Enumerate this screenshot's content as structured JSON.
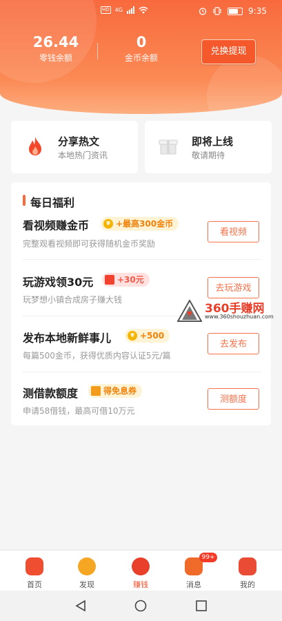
{
  "status_bar": {
    "hd_label": "HD",
    "net_label": "4G",
    "time": "9:35"
  },
  "wallet": {
    "change_value": "26.44",
    "change_label": "零钱余额",
    "coin_value": "0",
    "coin_label": "金币余额",
    "redeem_button": "兑换提现"
  },
  "features": [
    {
      "title": "分享热文",
      "subtitle": "本地热门资讯",
      "icon": "fire-icon"
    },
    {
      "title": "即将上线",
      "subtitle": "敬请期待",
      "icon": "gift-box-icon"
    }
  ],
  "daily_section": {
    "title": "每日福利",
    "tasks": [
      {
        "title": "看视频赚金币",
        "badge": "+最高300金币",
        "badge_icon": "coin-icon",
        "desc": "完整观看视频即可获得随机金币奖励",
        "button": "看视频"
      },
      {
        "title": "玩游戏领30元",
        "badge": "+30元",
        "badge_icon": "red-envelope-icon",
        "desc": "玩梦想小镇合成房子赚大钱",
        "button": "去玩游戏"
      },
      {
        "title": "发布本地新鲜事儿",
        "badge": "+500",
        "badge_icon": "coin-icon",
        "desc": "每篇500金币，获得优质内容认证5元/篇",
        "button": "去发布"
      },
      {
        "title": "测借款额度",
        "badge": "得免息券",
        "badge_icon": "coupon-icon",
        "desc": "申请58借钱，最高可借10万元",
        "button": "测额度"
      }
    ]
  },
  "watermark": {
    "brand": "360手赚网",
    "url": "www.360shouzhuan.com"
  },
  "tabbar": [
    {
      "label": "首页",
      "icon": "home-icon",
      "color": "#f04e30"
    },
    {
      "label": "发现",
      "icon": "discover-icon",
      "color": "#f5a623"
    },
    {
      "label": "赚钱",
      "icon": "earn-icon",
      "color": "#e8402a",
      "active": true
    },
    {
      "label": "消息",
      "icon": "message-icon",
      "color": "#f06a2a",
      "badge": "99+"
    },
    {
      "label": "我的",
      "icon": "profile-icon",
      "color": "#e94b35"
    }
  ],
  "colors": {
    "brand": "#f86a3e",
    "accent_button": "#f4582b",
    "task_button": "#f5714a",
    "coin_badge_bg": "#fff3d6",
    "coin_badge_text": "#f0820a"
  }
}
